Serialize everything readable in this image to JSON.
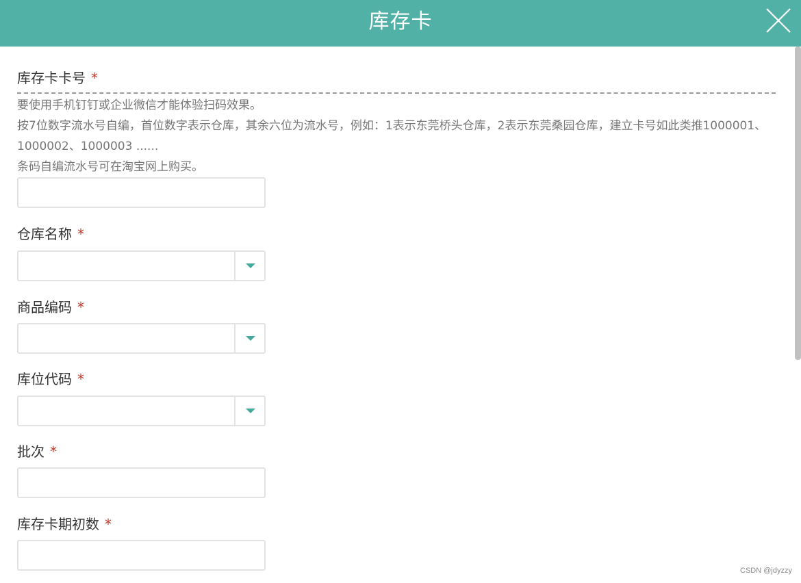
{
  "dialog": {
    "title": "库存卡"
  },
  "form": {
    "card_number": {
      "label": "库存卡卡号",
      "required_mark": "*",
      "help_lines": [
        "要使用手机钉钉或企业微信才能体验扫码效果。",
        "按7位数字流水号自编，首位数字表示仓库，其余六位为流水号，例如：1表示东莞桥头仓库，2表示东莞桑园仓库，建立卡号如此类推1000001、1000002、1000003 ......",
        "条码自编流水号可在淘宝网上购买。"
      ],
      "value": ""
    },
    "warehouse_name": {
      "label": "仓库名称",
      "required_mark": "*",
      "value": ""
    },
    "product_code": {
      "label": "商品编码",
      "required_mark": "*",
      "value": ""
    },
    "location_code": {
      "label": "库位代码",
      "required_mark": "*",
      "value": ""
    },
    "batch": {
      "label": "批次",
      "required_mark": "*",
      "value": ""
    },
    "initial_qty": {
      "label": "库存卡期初数",
      "required_mark": "*",
      "value": ""
    }
  },
  "watermark": "CSDN @jdyzzy",
  "colors": {
    "header_bg": "#52b1a6",
    "caret": "#45a99c",
    "required": "#c0392b"
  },
  "icons": {
    "close": "close-icon",
    "dropdown": "caret-down-icon"
  }
}
